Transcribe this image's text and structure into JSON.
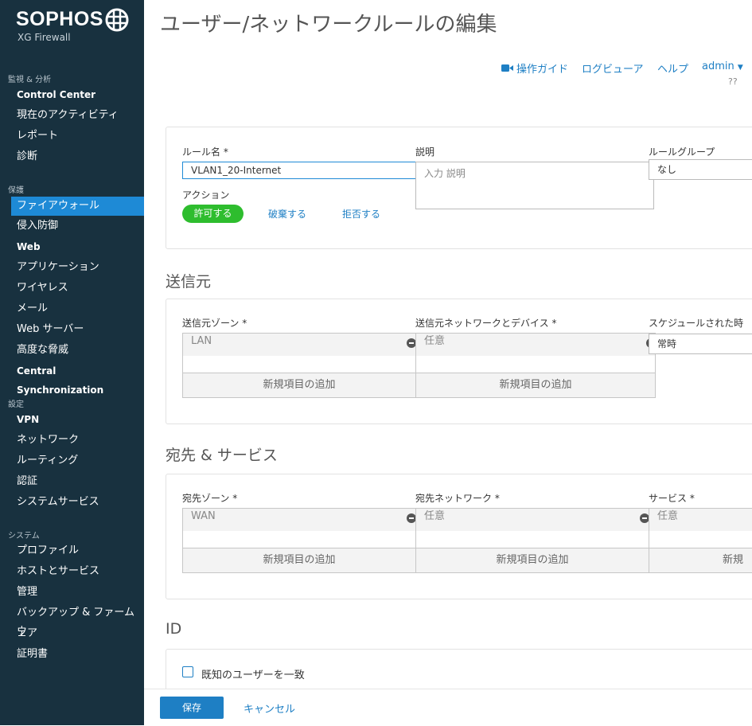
{
  "brand": {
    "name": "SOPHOS",
    "product": "XG Firewall"
  },
  "sidebar": {
    "sections": [
      {
        "title": "監視 & 分析",
        "items": [
          "Control Center",
          "現在のアクティビティ",
          "レポート",
          "診断"
        ]
      },
      {
        "title": "保護",
        "items": [
          "ファイアウォール",
          "侵入防御",
          "Web",
          "アプリケーション",
          "ワイヤレス",
          "メール",
          "Web サーバー",
          "高度な脅威",
          "Central Synchronization"
        ]
      },
      {
        "title": "設定",
        "items": [
          "VPN",
          "ネットワーク",
          "ルーティング",
          "認証",
          "システムサービス"
        ]
      },
      {
        "title": "システム",
        "items": [
          "プロファイル",
          "ホストとサービス",
          "管理",
          "バックアップ & ファームウ",
          "ェア",
          "証明書"
        ]
      }
    ],
    "active_item": "ファイアウォール"
  },
  "header": {
    "title": "ユーザー/ネットワークルールの編集",
    "links": {
      "guide": "操作ガイド",
      "log_viewer": "ログビューア",
      "help": "ヘルプ",
      "user": "admin"
    },
    "extra": "??"
  },
  "rule": {
    "name_label": "ルール名 *",
    "name_value": "VLAN1_20-Internet",
    "desc_label": "説明",
    "desc_placeholder": "入力 説明",
    "group_label": "ルールグループ",
    "group_value": "なし",
    "action_label": "アクション",
    "actions": {
      "allow": "許可する",
      "drop": "破棄する",
      "reject": "拒否する"
    },
    "selected_action": "許可する"
  },
  "source": {
    "heading": "送信元",
    "zone_label": "送信元ゾーン *",
    "zone_value": "LAN",
    "networks_label": "送信元ネットワークとデバイス *",
    "networks_value": "任意",
    "schedule_label": "スケジュールされた時",
    "schedule_value": "常時",
    "add_label": "新規項目の追加"
  },
  "destination": {
    "heading": "宛先 & サービス",
    "zone_label": "宛先ゾーン *",
    "zone_value": "WAN",
    "networks_label": "宛先ネットワーク *",
    "networks_value": "任意",
    "services_label": "サービス *",
    "services_value": "任意",
    "add_label": "新規項目の追加",
    "add_label_cut": "新規"
  },
  "identity": {
    "heading": "ID",
    "match_known_users": "既知のユーザーを一致",
    "checked": false
  },
  "footer": {
    "save": "保存",
    "cancel": "キャンセル"
  }
}
